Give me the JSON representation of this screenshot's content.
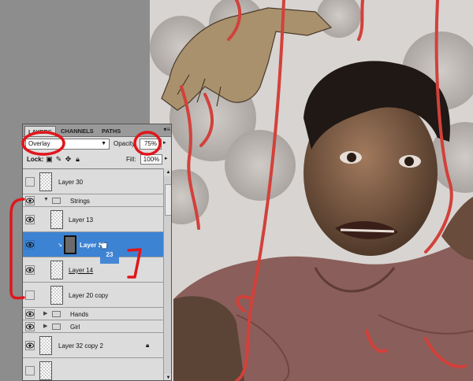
{
  "panel": {
    "tabs": [
      {
        "label": "LAYERS",
        "active": true
      },
      {
        "label": "CHANNELS",
        "active": false
      },
      {
        "label": "PATHS",
        "active": false
      }
    ],
    "menu_icon": "panel-menu-icon",
    "blend_mode": "Overlay",
    "opacity_label": "Opacity:",
    "opacity_value": "75%",
    "lock_label": "Lock:",
    "lock_icons": [
      "lock-transparent-pixels-icon",
      "lock-image-pixels-icon",
      "lock-position-icon",
      "lock-all-icon"
    ],
    "fill_label": "Fill:",
    "fill_value": "100%"
  },
  "layers": [
    {
      "name": "Layer 30",
      "visible": false,
      "type": "layer"
    },
    {
      "name": "Strings",
      "visible": true,
      "type": "group",
      "expanded": true
    },
    {
      "name": "Layer 13",
      "visible": true,
      "type": "layer"
    },
    {
      "name": "Layer 23",
      "visible": true,
      "type": "layer",
      "selected": true
    },
    {
      "name": "Layer 14",
      "visible": true,
      "type": "layer"
    },
    {
      "name": "Layer 20 copy",
      "visible": false,
      "type": "layer"
    },
    {
      "name": "Hands",
      "visible": true,
      "type": "group",
      "expanded": false
    },
    {
      "name": "Girl",
      "visible": true,
      "type": "group",
      "expanded": false
    },
    {
      "name": "Layer 32 copy 2",
      "visible": true,
      "type": "layer",
      "locked": true
    }
  ],
  "drag_ghost": "23",
  "colors": {
    "selection": "#3d83d4",
    "annotation": "#e0161b",
    "panel_bg": "#dcdcdc",
    "string": "#d2413b"
  }
}
